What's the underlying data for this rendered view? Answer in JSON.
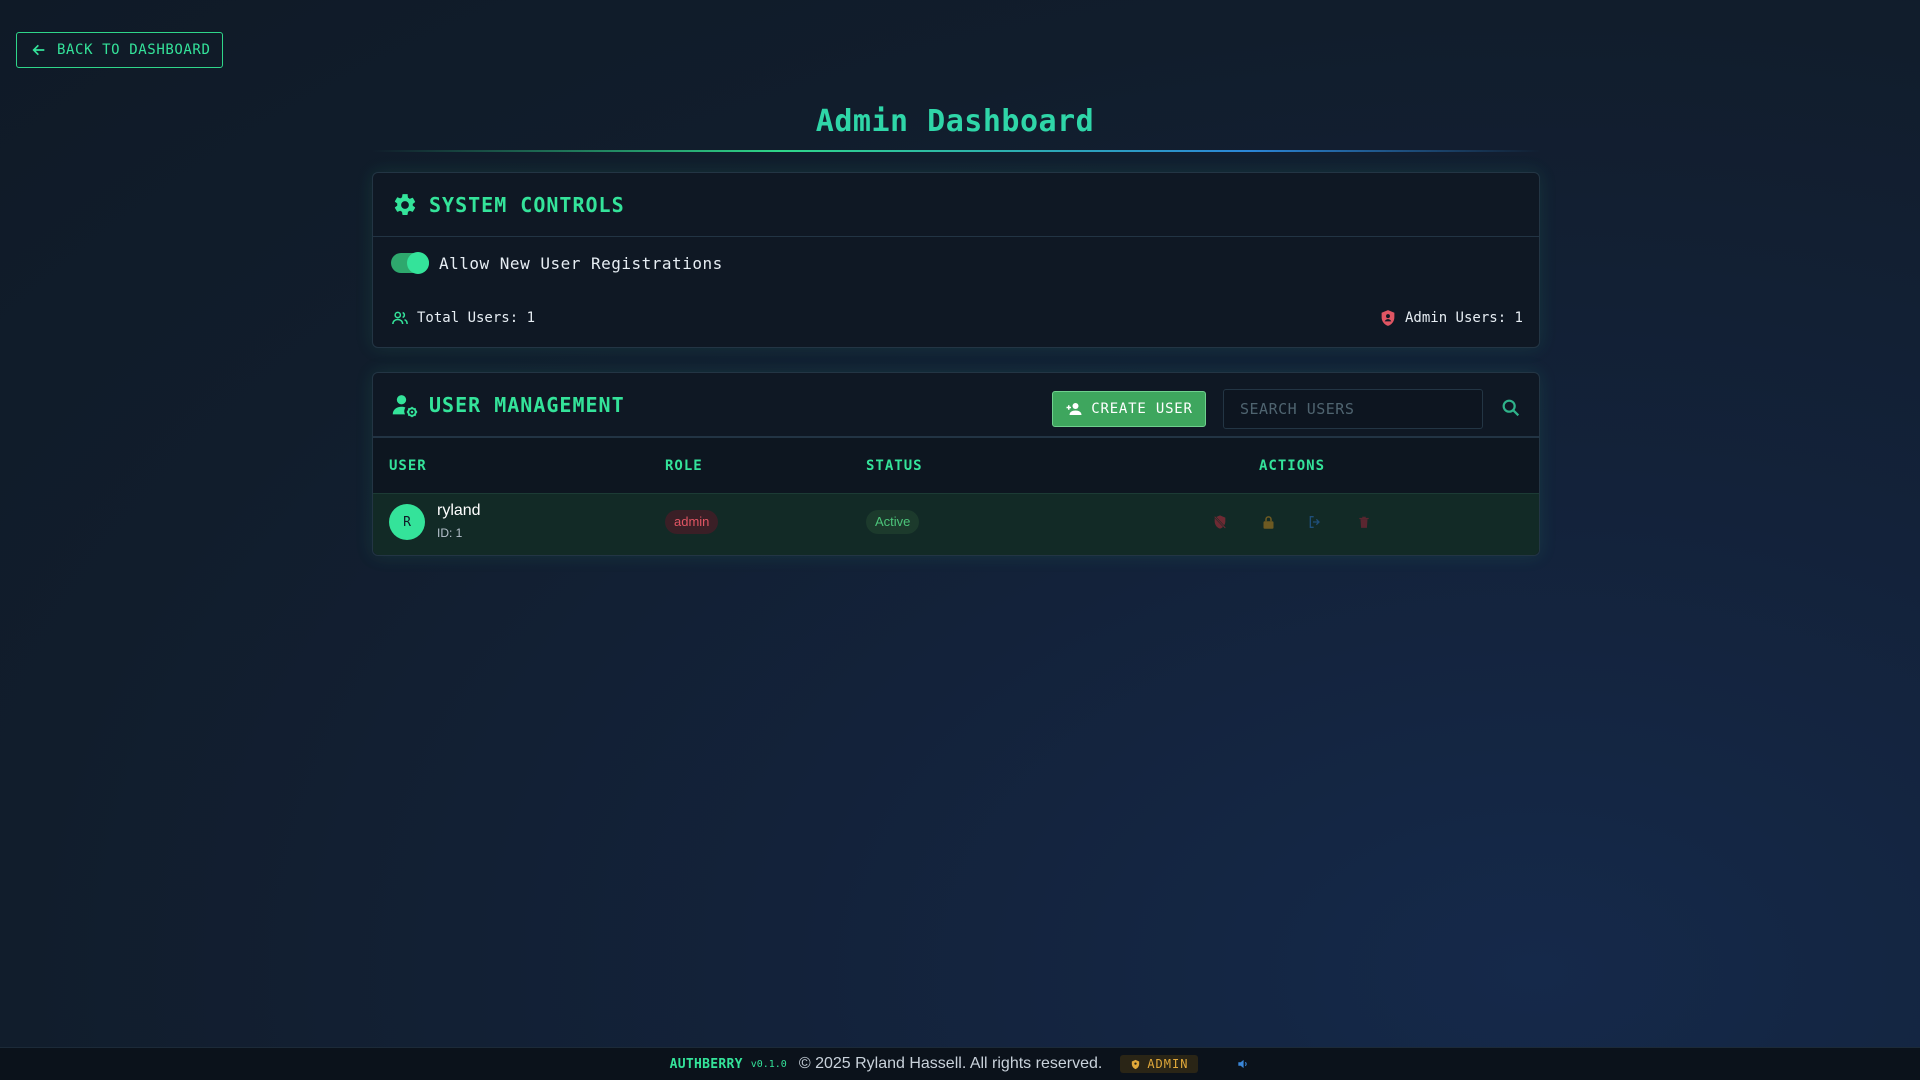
{
  "nav": {
    "back_label": "BACK TO DASHBOARD"
  },
  "page": {
    "title": "Admin Dashboard"
  },
  "system_controls": {
    "title": "SYSTEM CONTROLS",
    "registration_toggle_label": "Allow New User Registrations",
    "registration_enabled": true,
    "total_users_label": "Total Users: 1",
    "admin_users_label": "Admin Users: 1"
  },
  "user_management": {
    "title": "USER MANAGEMENT",
    "create_label": "CREATE USER",
    "search_placeholder": "SEARCH USERS",
    "columns": [
      "USER",
      "ROLE",
      "STATUS",
      "ACTIONS"
    ],
    "rows": [
      {
        "avatar_initial": "R",
        "username": "ryland",
        "id_label": "ID: 1",
        "role": "admin",
        "status": "Active"
      }
    ],
    "row_actions": [
      "shield-off-icon",
      "lock-icon",
      "logout-icon",
      "trash-icon"
    ]
  },
  "footer": {
    "brand": "AUTHBERRY",
    "version": "v0.1.0",
    "copyright": "© 2025 Ryland Hassell. All rights reserved.",
    "badge": "ADMIN"
  },
  "colors": {
    "accent": "#34e39a",
    "create_button": "#3ea65e",
    "role_admin": "#e05563",
    "status_active": "#4cc47a",
    "admin_badge": "#e1a93a"
  }
}
